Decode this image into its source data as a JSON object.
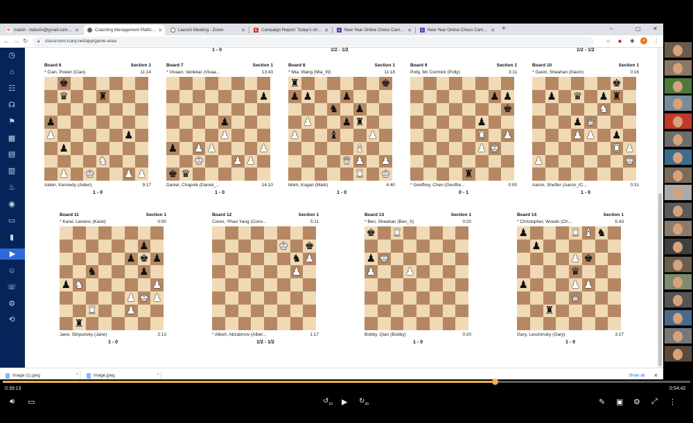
{
  "browser": {
    "tabs": [
      {
        "title": "match - baburin@gmail.com - Gm",
        "icon": "gmail-icon",
        "color": "#ea4335",
        "glyph": "M",
        "active": false
      },
      {
        "title": "Coaching Management Platform",
        "icon": "chessmaster-icon",
        "color": "#5f6368",
        "glyph": "◐",
        "active": true
      },
      {
        "title": "Launch Meeting - Zoom",
        "icon": "globe-icon",
        "color": "#5f6368",
        "glyph": "◉",
        "active": false
      },
      {
        "title": "Campaign Report: Today's chess",
        "icon": "campaign-icon",
        "color": "#d93025",
        "glyph": "C",
        "active": false
      },
      {
        "title": "New Year Online Chess Camp, 20",
        "icon": "form-icon",
        "color": "#673ab7",
        "glyph": "≡",
        "active": false
      },
      {
        "title": "New Year Online Chess Camp, 20",
        "icon": "form-icon",
        "color": "#673ab7",
        "glyph": "≡",
        "active": false
      }
    ],
    "new_tab": "+",
    "url": "classroom.icanj.net/app/game-area",
    "profile_initial": "A"
  },
  "sidebar_icons": [
    "dashboard-icon",
    "home-icon",
    "org-chart-icon",
    "headset-icon",
    "flag-icon",
    "grid-icon",
    "layers-icon",
    "table-icon",
    "fire-icon",
    "eye-icon",
    "inbox-icon",
    "bar-chart-icon",
    "play-icon",
    "users-icon",
    "chat-icon",
    "settings-icon",
    "logout-icon"
  ],
  "top_partial_results": [
    "1 - 0",
    "1/2 - 1/2",
    "1/2 - 1/2"
  ],
  "boards": [
    {
      "title": "Board 6",
      "section": "Section 1",
      "top_player": "* Cian, Power (Cian)",
      "top_time": "11:14",
      "bottom_player": "Aiden, Kennedy (Aiden)",
      "bottom_time": "9:17",
      "result": "1 - 0",
      "fen": "1k6/1q2r3/8/p7/P5p1/1p6/4N3/1P1K2PP"
    },
    {
      "title": "Board 7",
      "section": "Section 1",
      "top_player": "* Vivaan, Verlekar (Vivaa...",
      "top_time": "13:43",
      "bottom_player": "Daniel, Chapnik (Daniel_...",
      "bottom_time": "14:10",
      "result": "1 - 0",
      "fen": "8/7p/8/4p3/4P3/p1PP3P/2K2PP1/kq6"
    },
    {
      "title": "Board 8",
      "section": "Section 1",
      "top_player": "* Mia, Wang (Mia_W)",
      "top_time": "11:18",
      "bottom_player": "Mark, Kogan (Mark)",
      "bottom_time": "4:40",
      "result": "1 - 0",
      "fen": "r6k/pp2p3/3n1p2/1P2pr2/P2b2P1/5B2/4QP1P/5R1K"
    },
    {
      "title": "Board 9",
      "section": "Section 1",
      "top_player": "Polly, Mc Cormick (Polly)",
      "top_time": "3:11",
      "bottom_player": "* Geoffrey, Chen (Geoffre...",
      "bottom_time": "0:00",
      "result": "0 - 1",
      "fen": "8/6pp/7k/5p2/5R1P/5PK1/8/4r3"
    },
    {
      "title": "Board 10",
      "section": "Section 1",
      "top_player": "* Gavin, Sheahan (Gavin)",
      "top_time": "0:16",
      "bottom_player": "Aaron, Shefter (Aaron_IC...",
      "bottom_time": "0:31",
      "result": "1 - 0",
      "fen": "6k1/1p1q1pr1/5N2/3pQ3/3PP1p1/6RP/P6K/8"
    },
    {
      "title": "Board 11",
      "section": "Section 1",
      "top_player": "* Karel, Lievens (Karel)",
      "top_time": "0:00",
      "bottom_player": "Jane, Stripunsky (Jane)",
      "bottom_time": "2:13",
      "result": "1 - 0",
      "fen": "8/6p1/5pkp/2n3p1/pN5P/5PKP/2R2P2/1r6"
    },
    {
      "title": "Board 12",
      "section": "Section 1",
      "top_player": "Conor, Yihao Yang (Cono...",
      "top_time": "5:11",
      "bottom_player": "* Albert, Abzalimov (Alber...",
      "bottom_time": "1:17",
      "result": "1/2 - 1/2",
      "fen": "8/5K1k/6nP/6P1/8/8/8/8"
    },
    {
      "title": "Board 13",
      "section": "Section 1",
      "top_player": "* Ben, Sheahan (Ben_S)",
      "top_time": "0:20",
      "bottom_player": "Bobby, Qian (Bobby)",
      "bottom_time": "0:20",
      "result": "1 - 0",
      "fen": "k1R5/8/pK6/P2P4/8/8/8/8"
    },
    {
      "title": "Board 14",
      "section": "Section 1",
      "top_player": "* Christopher, Woods (Ch...",
      "top_time": "5:43",
      "bottom_player": "Gary, Leschinsky (Gary)",
      "bottom_time": "3:27",
      "result": "1 - 0",
      "fen": "p3RBn1/1p6/4Pk2/4q3/p3PP2/4Q3/2r5/8"
    }
  ],
  "downloads": [
    {
      "name": "Image (1).jpeg"
    },
    {
      "name": "Image.jpeg"
    }
  ],
  "show_all": "Show all",
  "video": {
    "elapsed": "0:39:13",
    "total": "0:54:42",
    "progress": 0.716,
    "rewind_label": "10",
    "forward_label": "30"
  }
}
